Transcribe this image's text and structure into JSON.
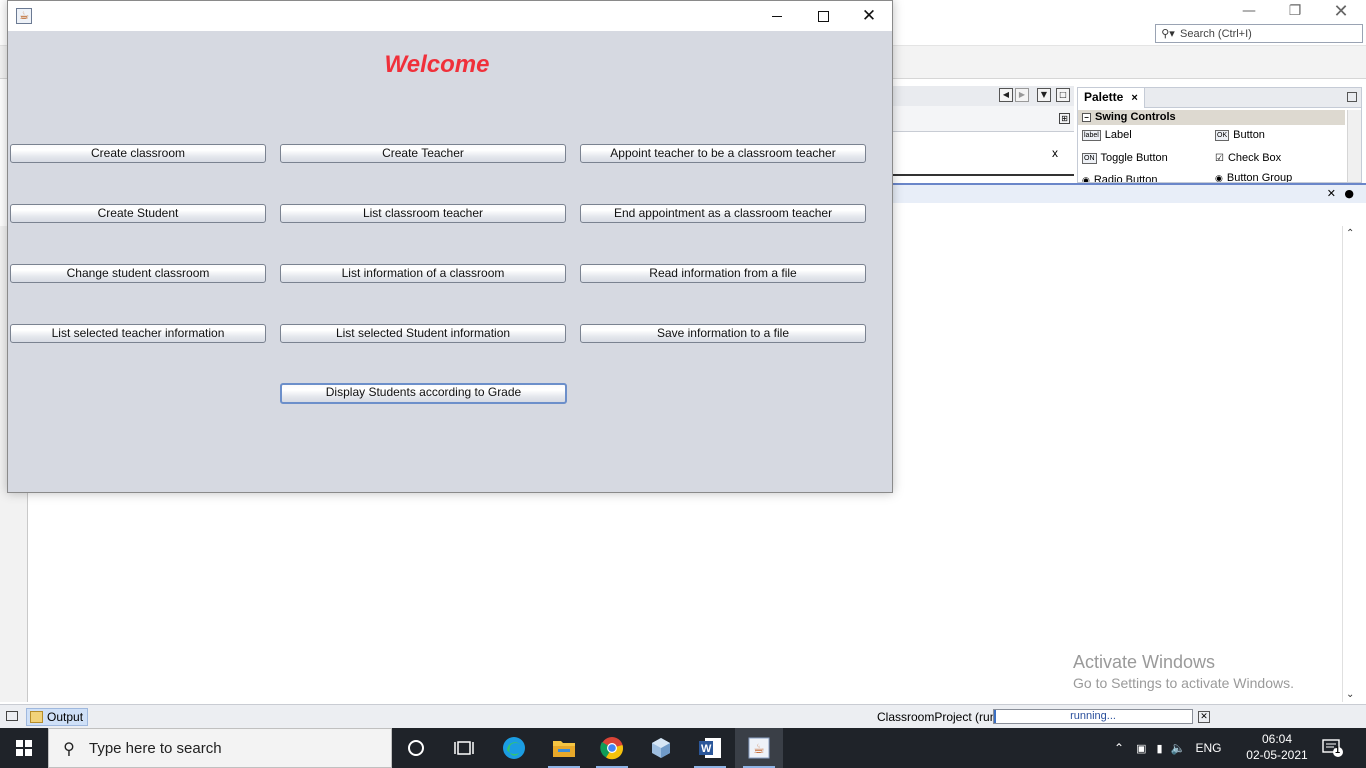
{
  "ide": {
    "search_placeholder": "Search (Ctrl+I)",
    "editor_close": "x",
    "palette": {
      "tab_label": "Palette",
      "tab_close": "×",
      "category": "Swing Controls",
      "items": [
        "Label",
        "Button",
        "Toggle Button",
        "Check Box",
        "Radio Button",
        "Button Group"
      ],
      "item_icons": [
        "label",
        "OK",
        "ON",
        "☑",
        "◉",
        "◉"
      ]
    },
    "output_tab": "Output",
    "status": {
      "project": "ClassroomProject (run)",
      "progress_text": "running...",
      "progress_fraction": 0.01
    },
    "watermark": {
      "line1": "Activate Windows",
      "line2": "Go to Settings to activate Windows."
    }
  },
  "app": {
    "welcome": "Welcome",
    "buttons": {
      "create_classroom": "Create classroom",
      "create_teacher": "Create Teacher",
      "appoint_teacher": "Appoint teacher to be a classroom teacher",
      "create_student": "Create Student",
      "list_classroom_teacher": "List classroom teacher",
      "end_appointment": "End appointment as a classroom teacher",
      "change_student_classroom": "Change student classroom",
      "list_classroom_info": "List information of a classroom",
      "read_file": "Read information from a file",
      "list_teacher_info": "List selected teacher information",
      "list_student_info": "List selected Student information",
      "save_file": "Save information to a file",
      "display_by_grade": "Display Students according to Grade"
    }
  },
  "taskbar": {
    "search_placeholder": "Type here to search",
    "language": "ENG",
    "time": "06:04",
    "date": "02-05-2021",
    "notification_count": "1"
  },
  "colors": {
    "welcome_red": "#f0303a",
    "app_bg": "#d6d9e1",
    "taskbar_bg": "#1f2329",
    "progress_blue": "#3b6fc2"
  }
}
